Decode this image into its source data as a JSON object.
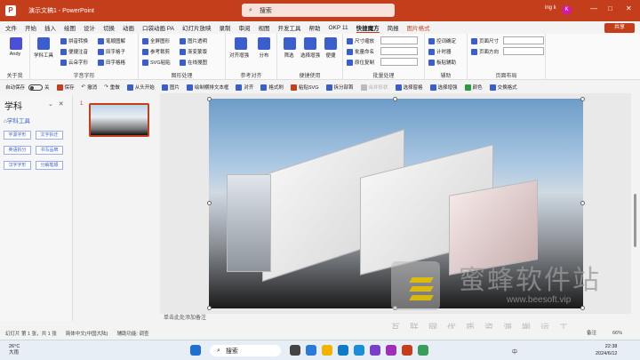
{
  "titlebar": {
    "title": "演示文稿1 - PowerPoint",
    "search_placeholder": "搜索",
    "user": "ing k",
    "avatar": "K",
    "minimize": "—",
    "maximize": "□",
    "close": "✕"
  },
  "menu": {
    "tabs": [
      "文件",
      "开始",
      "插入",
      "绘图",
      "设计",
      "切换",
      "动画",
      "口袋动画 PA",
      "幻灯片放映",
      "录制",
      "审阅",
      "视图",
      "开发工具",
      "帮助",
      "OKP 11",
      "快捷魔方",
      "简报",
      "图片格式"
    ],
    "active": "快捷魔方",
    "share": "共享"
  },
  "ribbon": {
    "groups": {
      "about": {
        "label": "关于我",
        "btn": "Andy"
      },
      "fonts": {
        "label": "字音字形",
        "big": "学科工具",
        "items": [
          "拼音转换",
          "笔顺图解",
          "便捷注音",
          "田字格子",
          "云朵字形",
          "田字格格"
        ]
      },
      "shapes": {
        "label": "图形处理",
        "items": [
          "全屏图形",
          "图片透明",
          "参考裁剪",
          "渐变蒙版",
          "SVG粘贴",
          "在线搜图"
        ]
      },
      "align": {
        "label": "参考对齐",
        "items": [
          "对齐增强",
          "分布"
        ]
      },
      "quick": {
        "label": "便捷使用",
        "items": [
          "筛选",
          "选择增强",
          "便捷"
        ]
      },
      "batch": {
        "label": "批量处理",
        "items": [
          "尺寸缩放",
          "批量命名",
          "原位复制"
        ]
      },
      "assist": {
        "label": "辅助",
        "items": [
          "控词确定",
          "计时器",
          "板贴辅助"
        ]
      },
      "layout": {
        "label": "页面布局",
        "items": [
          "页面尺寸",
          "页面方向"
        ]
      }
    }
  },
  "toolbar2": {
    "autosave": "自动保存",
    "autosave_state": "关",
    "items": [
      "保存",
      "撤消",
      "重做",
      "从头开始",
      "图片",
      "绘制横排文本框",
      "对齐",
      "格式刷",
      "粘贴SVG",
      "拆分部首",
      "合并形状",
      "选择窗格",
      "选择增强",
      "颜色",
      "交换格式"
    ]
  },
  "leftpanel": {
    "title": "学科",
    "subtitle": "⌂学科工具",
    "chips": [
      "字源字形",
      "文字拆迁",
      "英语拆分",
      "书写品牌",
      "汉字字形",
      "分解笔顺"
    ]
  },
  "thumbs": {
    "num": "1"
  },
  "notes": {
    "placeholder": "单击此处添加备注"
  },
  "status": {
    "slide": "幻灯片 第 1 张，共 1 张",
    "lang": "简体中文(中国大陆)",
    "access": "辅助功能: 调查",
    "notes_btn": "备注",
    "zoom": "66%"
  },
  "watermark": {
    "big": "蜜蜂软件站",
    "url": "www.beesoft.vip",
    "line": "互联网优质资源搬运工"
  },
  "taskbar": {
    "temp": "26°C",
    "weather": "大雨",
    "search": "搜索",
    "time": "22:38",
    "date": "2024/6/12",
    "lang": "中"
  }
}
